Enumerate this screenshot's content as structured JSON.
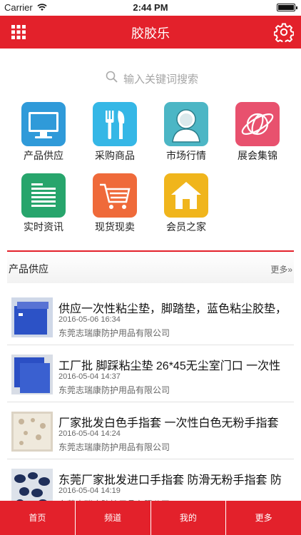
{
  "status_bar": {
    "carrier": "Carrier",
    "time": "2:44 PM"
  },
  "navbar": {
    "title": "胶胶乐"
  },
  "search": {
    "placeholder": "输入关键词搜索"
  },
  "categories": [
    {
      "label": "产品供应",
      "icon": "monitor-icon",
      "color": "#2f9ad9"
    },
    {
      "label": "采购商品",
      "icon": "fork-knife-icon",
      "color": "#35b7e6"
    },
    {
      "label": "市场行情",
      "icon": "person-icon",
      "color": "#4cb6c5"
    },
    {
      "label": "展会集锦",
      "icon": "globe-icon",
      "color": "#e8516e"
    },
    {
      "label": "实时资讯",
      "icon": "document-icon",
      "color": "#27a56c"
    },
    {
      "label": "现货现卖",
      "icon": "cart-icon",
      "color": "#ef6a3a"
    },
    {
      "label": "会员之家",
      "icon": "home-icon",
      "color": "#f0b51c"
    }
  ],
  "section": {
    "name": "产品供应",
    "more": "更多»"
  },
  "items": [
    {
      "title": "供应一次性粘尘垫，脚踏垫，蓝色粘尘胶垫，",
      "date": "2016-05-06 16:34",
      "company": "东莞志瑞康防护用品有限公司"
    },
    {
      "title": "工厂批 脚踩粘尘垫 26*45无尘室门口 一次性",
      "date": "2016-05-04 14:37",
      "company": "东莞志瑞康防护用品有限公司"
    },
    {
      "title": "厂家批发白色手指套 一次性白色无粉手指套",
      "date": "2016-05-04 14:24",
      "company": "东莞志瑞康防护用品有限公司"
    },
    {
      "title": "东莞厂家批发进口手指套 防滑无粉手指套 防",
      "date": "2016-05-04 14:19",
      "company": "东莞志瑞康防护用品有限公司"
    }
  ],
  "tabs": [
    {
      "label": "首页"
    },
    {
      "label": "频道"
    },
    {
      "label": "我的"
    },
    {
      "label": "更多"
    }
  ]
}
